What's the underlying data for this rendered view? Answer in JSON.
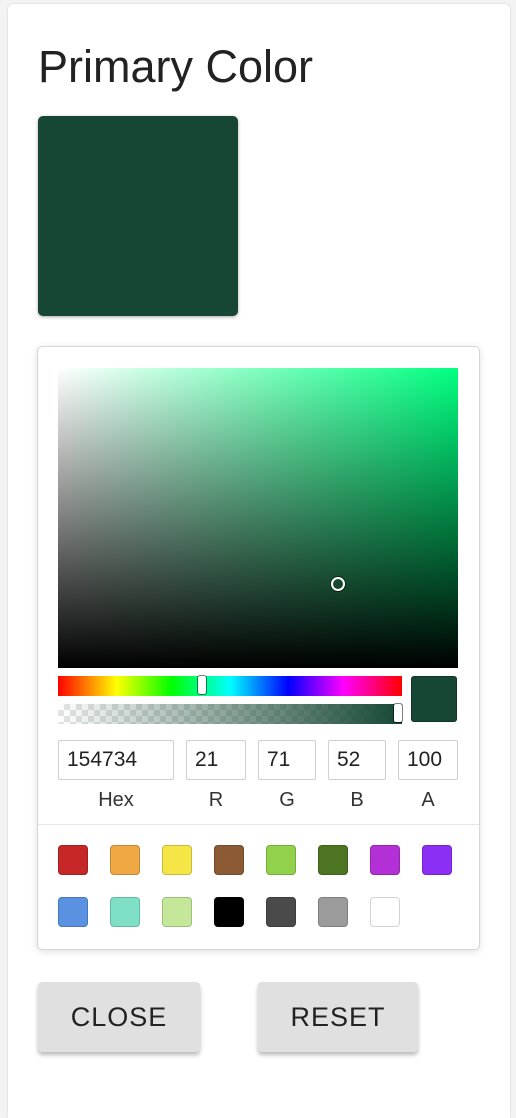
{
  "title": "Primary Color",
  "selected_color": "#154734",
  "picker": {
    "hue_color": "#00ff80",
    "saturation": 0.7,
    "value": 0.28,
    "hue_position": 0.42,
    "alpha_position": 1.0,
    "fields": {
      "hex": {
        "value": "154734",
        "label": "Hex"
      },
      "r": {
        "value": "21",
        "label": "R"
      },
      "g": {
        "value": "71",
        "label": "G"
      },
      "b": {
        "value": "52",
        "label": "B"
      },
      "a": {
        "value": "100",
        "label": "A"
      }
    },
    "presets": [
      "#c62828",
      "#f0a845",
      "#f5e547",
      "#8b5a32",
      "#92d14a",
      "#4d7421",
      "#b32fd6",
      "#8b2ff5",
      "#5a91e0",
      "#7fe0c7",
      "#c5e79a",
      "#000000",
      "#4a4a4a",
      "#9b9b9b",
      "#ffffff"
    ]
  },
  "buttons": {
    "close_label": "CLOSE",
    "reset_label": "RESET"
  }
}
